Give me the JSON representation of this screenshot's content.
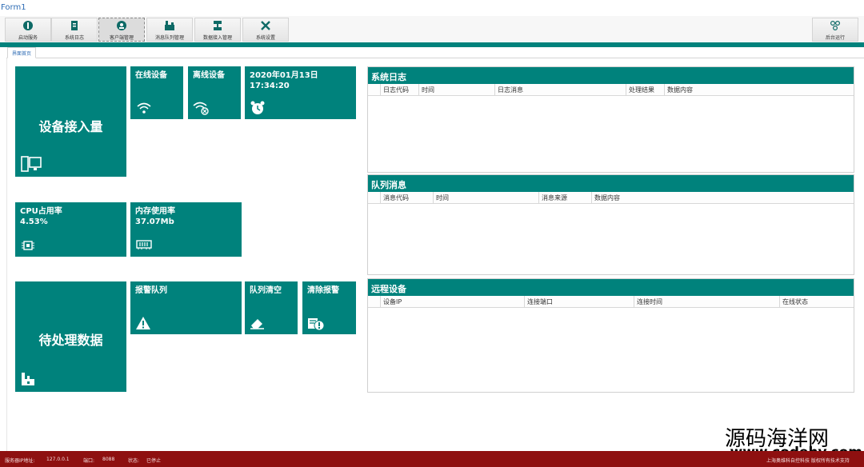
{
  "window": {
    "title": "Form1"
  },
  "toolbar": {
    "buttons": [
      {
        "label": "启动服务",
        "icon": "power-icon"
      },
      {
        "label": "系统日志",
        "icon": "log-icon"
      },
      {
        "label": "客户端管理",
        "icon": "client-icon"
      },
      {
        "label": "消息队列管理",
        "icon": "queue-icon"
      },
      {
        "label": "数据接入管理",
        "icon": "data-access-icon"
      },
      {
        "label": "系统设置",
        "icon": "tools-icon"
      }
    ],
    "right_button": {
      "label": "后台运行",
      "icon": "background-run-icon"
    }
  },
  "tab": {
    "label": "界面首页"
  },
  "tiles": {
    "device_access": {
      "label": "设备接入量",
      "icon": "devices-icon"
    },
    "online": {
      "label": "在线设备",
      "icon": "wifi-icon"
    },
    "offline": {
      "label": "离线设备",
      "icon": "wifi-off-icon"
    },
    "datetime": {
      "date": "2020年01月13日",
      "time": "17:34:20",
      "icon": "alarm-clock-icon"
    },
    "cpu": {
      "label": "CPU占用率",
      "value": "4.53%",
      "icon": "cpu-icon"
    },
    "memory": {
      "label": "内存使用率",
      "value": "37.07Mb",
      "icon": "memory-icon"
    },
    "pending": {
      "label": "待处理数据",
      "icon": "factory-icon"
    },
    "alarm_queue": {
      "label": "报警队列",
      "icon": "warning-icon"
    },
    "clear_queue": {
      "label": "队列清空",
      "icon": "eraser-icon"
    },
    "clear_alarm": {
      "label": "清除报警",
      "icon": "clear-alarm-icon"
    }
  },
  "panels": {
    "system_log": {
      "title": "系统日志",
      "columns": [
        "日志代码",
        "时间",
        "日志消息",
        "处理结果",
        "数据内容"
      ]
    },
    "queue_messages": {
      "title": "队列消息",
      "columns": [
        "消息代码",
        "时间",
        "消息来源",
        "数据内容"
      ]
    },
    "remote_devices": {
      "title": "远程设备",
      "columns": [
        "设备IP",
        "连接端口",
        "连接时间",
        "在线状态"
      ]
    }
  },
  "statusbar": {
    "ip_label": "服务器IP地址:",
    "ip_value": "127.0.0.1",
    "port_label": "端口:",
    "port_value": "8088",
    "state_label": "状态:",
    "state_value": "已停止",
    "right_text": "上海奥维科自控科技   版权所有技术支持"
  },
  "watermark": {
    "line1": "源码海洋网",
    "line2": "www.codehy.com"
  },
  "colors": {
    "accent": "#00827c",
    "status_bar": "#8e1010",
    "title_text": "#2f6db5"
  }
}
